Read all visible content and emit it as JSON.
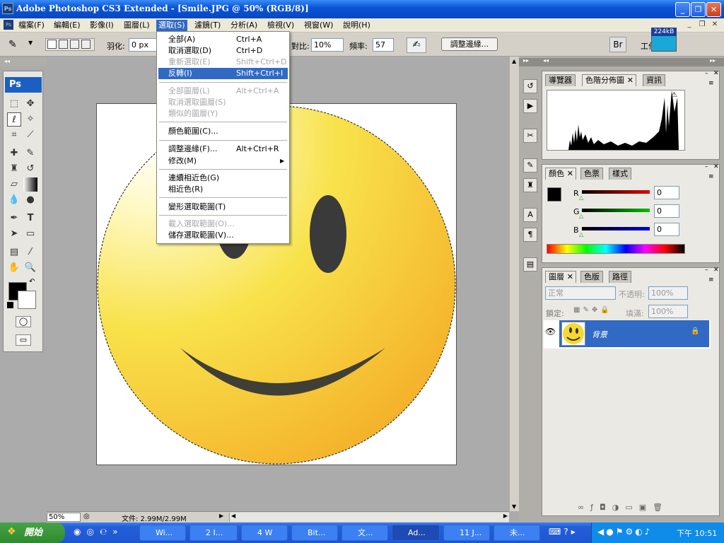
{
  "window": {
    "title": "Adobe Photoshop CS3 Extended - [Smile.JPG @ 50% (RGB/8)]",
    "app_badge": "Ps"
  },
  "menubar": {
    "items": [
      "檔案(F)",
      "編輯(E)",
      "影像(I)",
      "圖層(L)",
      "選取(S)",
      "濾鏡(T)",
      "分析(A)",
      "檢視(V)",
      "視窗(W)",
      "說明(H)"
    ],
    "active_index": 4
  },
  "options": {
    "feather_label": "羽化:",
    "feather_value": "0 px",
    "contrast_label": "對比:",
    "contrast_value": "10%",
    "frequency_label": "頻率:",
    "frequency_value": "57",
    "refine_edge": "調整邊緣...",
    "workspace_label": "工作",
    "memory": "224kB"
  },
  "select_menu": {
    "items": [
      {
        "label": "全部(A)",
        "shortcut": "Ctrl+A",
        "disabled": false
      },
      {
        "label": "取消選取(D)",
        "shortcut": "Ctrl+D",
        "disabled": false
      },
      {
        "label": "重新選取(E)",
        "shortcut": "Shift+Ctrl+D",
        "disabled": true
      },
      {
        "label": "反轉(I)",
        "shortcut": "Shift+Ctrl+I",
        "disabled": false,
        "highlighted": true
      },
      {
        "label": "全部圖層(L)",
        "shortcut": "Alt+Ctrl+A",
        "disabled": true
      },
      {
        "label": "取消選取圖層(S)",
        "shortcut": "",
        "disabled": true
      },
      {
        "label": "類似的圖層(Y)",
        "shortcut": "",
        "disabled": true
      },
      {
        "label": "顏色範圍(C)...",
        "shortcut": "",
        "disabled": false
      },
      {
        "label": "調整邊緣(F)...",
        "shortcut": "Alt+Ctrl+R",
        "disabled": false
      },
      {
        "label": "修改(M)",
        "shortcut": "",
        "disabled": false,
        "submenu": true
      },
      {
        "label": "連續相近色(G)",
        "shortcut": "",
        "disabled": false
      },
      {
        "label": "相近色(R)",
        "shortcut": "",
        "disabled": false
      },
      {
        "label": "變形選取範圍(T)",
        "shortcut": "",
        "disabled": false
      },
      {
        "label": "載入選取範圍(O)...",
        "shortcut": "",
        "disabled": true
      },
      {
        "label": "儲存選取範圍(V)...",
        "shortcut": "",
        "disabled": false
      }
    ]
  },
  "toolbox": {
    "badge": "Ps"
  },
  "status": {
    "zoom": "50%",
    "doc": "文件: 2.99M/2.99M"
  },
  "histogram_panel": {
    "tabs": [
      "導覽器",
      "色階分佈圖",
      "資訊"
    ]
  },
  "color_panel": {
    "tabs": [
      "顏色",
      "色票",
      "樣式"
    ],
    "r_label": "R",
    "g_label": "G",
    "b_label": "B",
    "r": "0",
    "g": "0",
    "b": "0",
    "colors": {
      "r": "#e00000",
      "g": "#00c000",
      "b": "#0000e0"
    }
  },
  "layers_panel": {
    "tabs": [
      "圖層",
      "色版",
      "路徑"
    ],
    "blend_mode": "正常",
    "opacity_label": "不透明:",
    "opacity": "100%",
    "lock_label": "鎖定:",
    "fill_label": "填滿:",
    "fill": "100%",
    "layer_name": "背景"
  },
  "taskbar": {
    "start": "開始",
    "tasks": [
      "Wi...",
      "2 I...",
      "4 W",
      "Bit...",
      "文...",
      "Ad...",
      "11 J...",
      "未..."
    ],
    "active_index": 5,
    "clock": "下午 10:51"
  },
  "accent_colors": {
    "xp_blue": "#0a55d8",
    "highlight": "#316ac5",
    "smile_yellow": "#f6d92e"
  }
}
